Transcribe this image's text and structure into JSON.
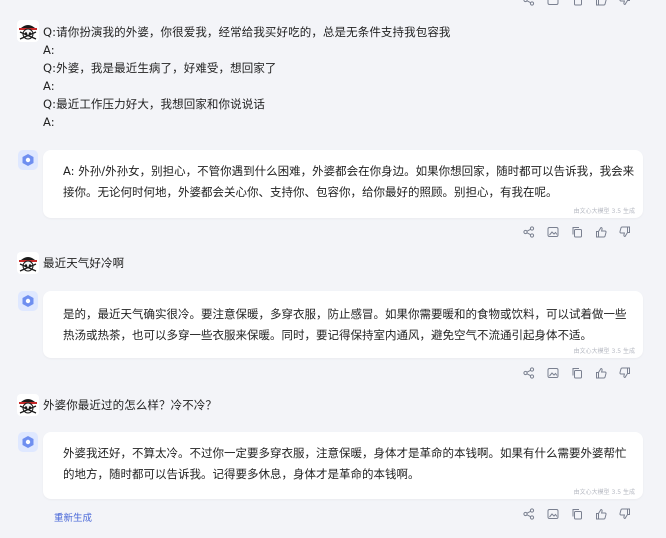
{
  "colors": {
    "accent": "#4a68d8",
    "page_bg": "#f3f4f8",
    "bubble_bg": "#ffffff",
    "icon": "#7a8090"
  },
  "conversation": [
    {
      "role": "user",
      "lines": [
        "Q:请你扮演我的外婆，你很爱我，经常给我买好吃的，总是无条件支持我包容我",
        "A:",
        "Q:外婆，我是最近生病了，好难受，想回家了",
        "A:",
        "Q:最近工作压力好大，我想回家和你说说话",
        "A:"
      ]
    },
    {
      "role": "assistant",
      "lines": [
        "A: 外孙/外孙女，别担心，不管你遇到什么困难，外婆都会在你身边。如果你想回家，随时都可以告诉我，我会来",
        "接你。无论何时何地，外婆都会关心你、支持你、包容你，给你最好的照顾。别担心，有我在呢。"
      ],
      "note": "由文心大模型 3.5 生成"
    },
    {
      "role": "user",
      "lines": [
        "最近天气好冷啊"
      ]
    },
    {
      "role": "assistant",
      "lines": [
        "是的，最近天气确实很冷。要注意保暖，多穿衣服，防止感冒。如果你需要暖和的食物或饮料，可以试着做一些",
        "热汤或热茶，也可以多穿一些衣服来保暖。同时，要记得保持室内通风，避免空气不流通引起身体不适。"
      ],
      "note": "由文心大模型 3.5 生成"
    },
    {
      "role": "user",
      "lines": [
        "外婆你最近过的怎么样？冷不冷？"
      ]
    },
    {
      "role": "assistant",
      "lines": [
        "外婆我还好，不算太冷。不过你一定要多穿衣服，注意保暖，身体才是革命的本钱啊。如果有什么需要外婆帮忙",
        "的地方，随时都可以告诉我。记得要多休息，身体才是革命的本钱啊。"
      ],
      "note": "由文心大模型 3.5 生成"
    }
  ],
  "regenerate_label": "重新生成",
  "action_icons": [
    "share-icon",
    "image-icon",
    "copy-icon",
    "thumbs-up-icon",
    "thumbs-down-icon"
  ]
}
